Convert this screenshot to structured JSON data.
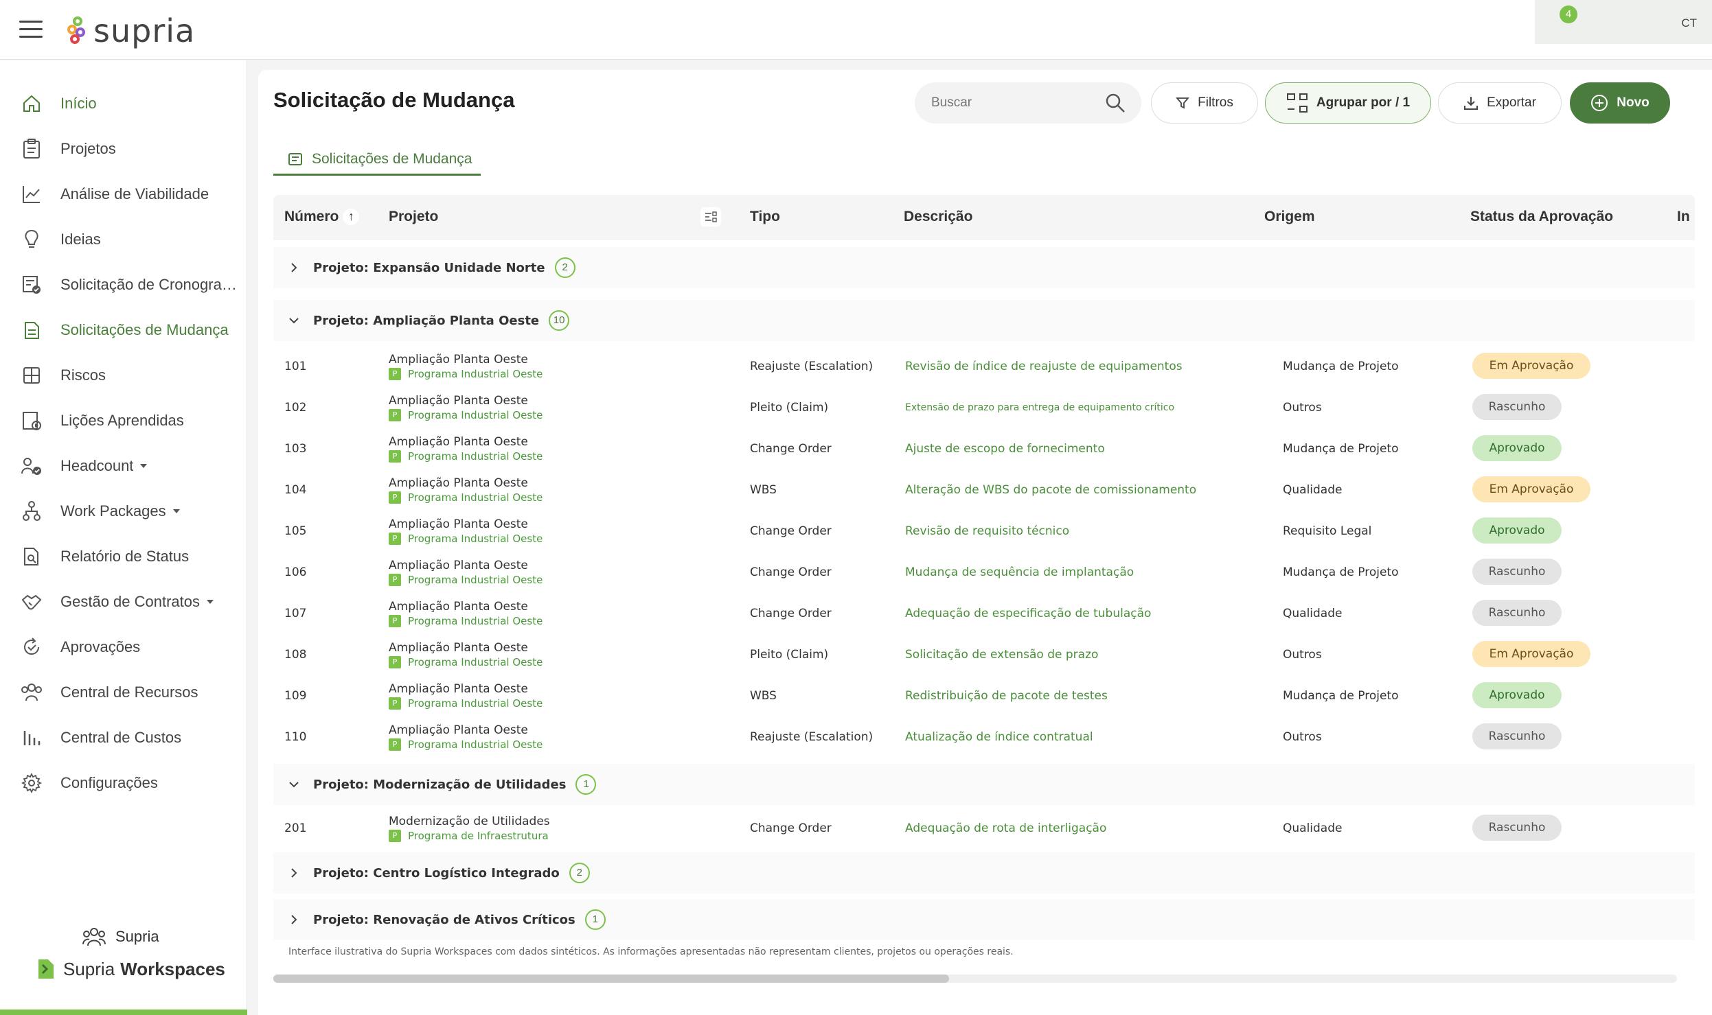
{
  "app": {
    "logo_text": "supria",
    "notif_count": "4",
    "user_initials": "CT"
  },
  "sidebar": {
    "items": [
      {
        "label": "Início",
        "icon": "home-icon",
        "active": true
      },
      {
        "label": "Projetos",
        "icon": "clipboard-icon"
      },
      {
        "label": "Análise de Viabilidade",
        "icon": "trend-chart-icon"
      },
      {
        "label": "Ideias",
        "icon": "lightbulb-icon"
      },
      {
        "label": "Solicitação de Cronograma",
        "icon": "schedule-check-icon"
      },
      {
        "label": "Solicitações de Mudança",
        "icon": "document-stack-icon",
        "active": true
      },
      {
        "label": "Riscos",
        "icon": "grid-icon"
      },
      {
        "label": "Lições Aprendidas",
        "icon": "video-doc-icon"
      },
      {
        "label": "Headcount",
        "icon": "people-check-icon",
        "caret": true
      },
      {
        "label": "Work Packages",
        "icon": "hierarchy-icon",
        "caret": true
      },
      {
        "label": "Relatório de Status",
        "icon": "doc-search-icon"
      },
      {
        "label": "Gestão de Contratos",
        "icon": "handshake-icon",
        "caret": true
      },
      {
        "label": "Aprovações",
        "icon": "refresh-check-icon"
      },
      {
        "label": "Central de Recursos",
        "icon": "group-icon"
      },
      {
        "label": "Central de Custos",
        "icon": "bar-chart-icon"
      },
      {
        "label": "Configurações",
        "icon": "gear-icon"
      }
    ],
    "footer_org": "Supria",
    "footer_brand_a": "Supria",
    "footer_brand_b": "Workspaces"
  },
  "main": {
    "title": "Solicitação de Mudança",
    "search_placeholder": "Buscar",
    "filters_label": "Filtros",
    "group_label": "Agrupar por / 1",
    "export_label": "Exportar",
    "new_label": "Novo",
    "tab_label": "Solicitações de Mudança",
    "columns": [
      "Número",
      "Projeto",
      "Tipo",
      "Descrição",
      "Origem",
      "Status da Aprovação",
      "In"
    ],
    "disclaimer": "Interface ilustrativa do Supria Workspaces com dados sintéticos. As informações apresentadas não representam clientes, projetos ou operações reais."
  },
  "groups": [
    {
      "label": "Projeto: Expansão Unidade Norte",
      "count": "2",
      "expanded": false
    },
    {
      "label": "Projeto: Ampliação Planta Oeste",
      "count": "10",
      "expanded": true
    },
    {
      "label": "Projeto: Modernização de Utilidades",
      "count": "1",
      "expanded": true
    },
    {
      "label": "Projeto: Centro Logístico Integrado",
      "count": "2",
      "expanded": false
    },
    {
      "label": "Projeto: Renovação de Ativos Críticos",
      "count": "1",
      "expanded": false
    }
  ],
  "rows": [
    {
      "num": "101",
      "proj": "Ampliação Planta Oeste",
      "badge": "P",
      "prog": "Programa Industrial Oeste",
      "tipo": "Reajuste (Escalation)",
      "desc": "Revisão de índice de reajuste de equipamentos",
      "orig": "Mudança de Projeto",
      "status": "Em Aprovação"
    },
    {
      "num": "102",
      "proj": "Ampliação Planta Oeste",
      "badge": "P",
      "prog": "Programa Industrial Oeste",
      "tipo": "Pleito (Claim)",
      "desc": "Extensão de prazo para entrega de equipamento crítico",
      "orig": "Outros",
      "status": "Rascunho"
    },
    {
      "num": "103",
      "proj": "Ampliação Planta Oeste",
      "badge": "P",
      "prog": "Programa Industrial Oeste",
      "tipo": "Change Order",
      "desc": "Ajuste de escopo de fornecimento",
      "orig": "Mudança de Projeto",
      "status": "Aprovado"
    },
    {
      "num": "104",
      "proj": "Ampliação Planta Oeste",
      "badge": "P",
      "prog": "Programa Industrial Oeste",
      "tipo": "WBS",
      "desc": "Alteração de WBS do pacote de comissionamento",
      "orig": "Qualidade",
      "status": "Em Aprovação"
    },
    {
      "num": "105",
      "proj": "Ampliação Planta Oeste",
      "badge": "P",
      "prog": "Programa Industrial Oeste",
      "tipo": "Change Order",
      "desc": "Revisão de requisito técnico",
      "orig": "Requisito Legal",
      "status": "Aprovado"
    },
    {
      "num": "106",
      "proj": "Ampliação Planta Oeste",
      "badge": "P",
      "prog": "Programa Industrial Oeste",
      "tipo": "Change Order",
      "desc": "Mudança de sequência de implantação",
      "orig": "Mudança de Projeto",
      "status": "Rascunho"
    },
    {
      "num": "107",
      "proj": "Ampliação Planta Oeste",
      "badge": "P",
      "prog": "Programa Industrial Oeste",
      "tipo": "Change Order",
      "desc": "Adequação de especificação de tubulação",
      "orig": "Qualidade",
      "status": "Rascunho"
    },
    {
      "num": "108",
      "proj": "Ampliação Planta Oeste",
      "badge": "P",
      "prog": "Programa Industrial Oeste",
      "tipo": "Pleito (Claim)",
      "desc": "Solicitação de extensão de prazo",
      "orig": "Outros",
      "status": "Em Aprovação"
    },
    {
      "num": "109",
      "proj": "Ampliação Planta Oeste",
      "badge": "P",
      "prog": "Programa Industrial Oeste",
      "tipo": "WBS",
      "desc": "Redistribuição de pacote de testes",
      "orig": "Mudança de Projeto",
      "status": "Aprovado"
    },
    {
      "num": "110",
      "proj": "Ampliação Planta Oeste",
      "badge": "P",
      "prog": "Programa Industrial Oeste",
      "tipo": "Reajuste (Escalation)",
      "desc": "Atualização de índice contratual",
      "orig": "Outros",
      "status": "Rascunho"
    },
    {
      "num": "201",
      "proj": "Modernização de Utilidades",
      "badge": "P",
      "prog": "Programa de Infraestrutura",
      "tipo": "Change Order",
      "desc": "Adequação de rota de interligação",
      "orig": "Qualidade",
      "status": "Rascunho"
    }
  ],
  "colors": {
    "accent": "#4a7c3d",
    "brand_green": "#7cc14a"
  }
}
